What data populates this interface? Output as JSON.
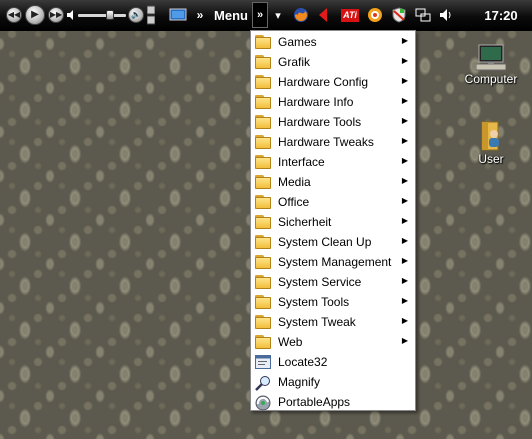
{
  "taskbar": {
    "media": {
      "prev_icon": "rewind-icon",
      "play_icon": "play-icon",
      "next_icon": "fast-forward-icon",
      "mute_icon": "speaker-icon",
      "volume_level": 0.7,
      "volume_max_icon": "speaker-loud-icon",
      "options_icon": "media-options-icon"
    },
    "desktop_icon": "show-desktop-icon",
    "chevron_left": "»",
    "menu_label": "Menu",
    "menu_chevron": "»",
    "dropdown_arrow": "▾",
    "tray_icons": [
      "firefox-icon",
      "red-arrow-icon",
      "ati-icon",
      "avira-icon",
      "shield-icon",
      "network-icon",
      "volume-icon"
    ],
    "ati_label": "ATi",
    "clock": "17:20"
  },
  "menu": {
    "items": [
      {
        "label": "Games",
        "icon": "folder-icon",
        "submenu": true
      },
      {
        "label": "Grafik",
        "icon": "folder-icon",
        "submenu": true
      },
      {
        "label": "Hardware Config",
        "icon": "folder-icon",
        "submenu": true
      },
      {
        "label": "Hardware Info",
        "icon": "folder-icon",
        "submenu": true
      },
      {
        "label": "Hardware Tools",
        "icon": "folder-icon",
        "submenu": true
      },
      {
        "label": "Hardware Tweaks",
        "icon": "folder-icon",
        "submenu": true
      },
      {
        "label": "Interface",
        "icon": "folder-icon",
        "submenu": true
      },
      {
        "label": "Media",
        "icon": "folder-icon",
        "submenu": true
      },
      {
        "label": "Office",
        "icon": "folder-icon",
        "submenu": true
      },
      {
        "label": "Sicherheit",
        "icon": "folder-icon",
        "submenu": true
      },
      {
        "label": "System Clean Up",
        "icon": "folder-icon",
        "submenu": true
      },
      {
        "label": "System Management",
        "icon": "folder-icon",
        "submenu": true
      },
      {
        "label": "System Service",
        "icon": "folder-icon",
        "submenu": true
      },
      {
        "label": "System Tools",
        "icon": "folder-icon",
        "submenu": true
      },
      {
        "label": "System Tweak",
        "icon": "folder-icon",
        "submenu": true
      },
      {
        "label": "Web",
        "icon": "folder-icon",
        "submenu": true
      },
      {
        "label": "Locate32",
        "icon": "locate32-icon",
        "submenu": false
      },
      {
        "label": "Magnify",
        "icon": "magnifier-icon",
        "submenu": false
      },
      {
        "label": "PortableApps",
        "icon": "portableapps-icon",
        "submenu": false
      }
    ],
    "submenu_arrow": "▶"
  },
  "desktop": {
    "icons": [
      {
        "label": "Computer",
        "icon": "computer-icon"
      },
      {
        "label": "User",
        "icon": "user-folder-icon"
      }
    ]
  },
  "colors": {
    "taskbar": "#000000",
    "menu_bg": "#ffffff",
    "folder": "#f2bf3c"
  }
}
